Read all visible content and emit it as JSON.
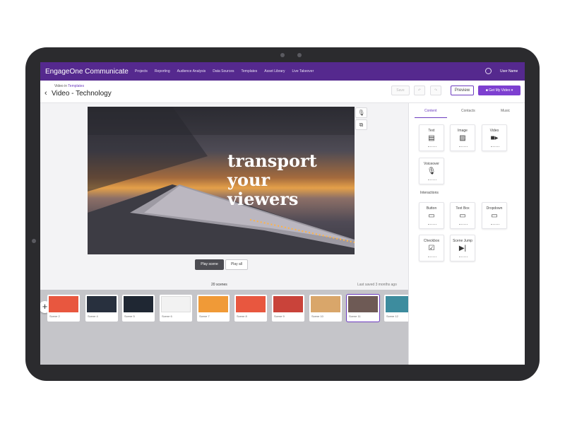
{
  "app": {
    "brand": "EngageOne Communicate",
    "nav": [
      "Projects",
      "Reporting",
      "Audience Analysis",
      "Data Sources",
      "Templates",
      "Asset Library",
      "Live Takeover"
    ],
    "user_name": "User Name"
  },
  "header": {
    "breadcrumb_prefix": "Video in",
    "breadcrumb_link": "Templates",
    "title": "Video - Technology",
    "save_label": "Save",
    "preview_label": "Preview",
    "get_video_label": "Get My Video"
  },
  "canvas": {
    "overlay_lines": [
      "transport",
      "your",
      "viewers"
    ],
    "play_scene_label": "Play scene",
    "play_all_label": "Play all",
    "scene_count": "20 scenes",
    "last_saved": "Last saved 3 months ago",
    "scenes": [
      {
        "label": "Scene 2",
        "color": "#e8573f"
      },
      {
        "label": "Scene 4",
        "color": "#28303e"
      },
      {
        "label": "Scene 5",
        "color": "#1f2733"
      },
      {
        "label": "Scene 6",
        "color": "#f2f2f2"
      },
      {
        "label": "Scene 7",
        "color": "#f09a37"
      },
      {
        "label": "Scene 8",
        "color": "#e8573f"
      },
      {
        "label": "Scene 9",
        "color": "#c9433a"
      },
      {
        "label": "Scene 10",
        "color": "#d9a66a"
      },
      {
        "label": "Scene 11",
        "color": "#6e5a55"
      },
      {
        "label": "Scene 12",
        "color": "#3d8c9e"
      }
    ]
  },
  "panel": {
    "tabs": [
      "Content",
      "Contacts",
      "Music"
    ],
    "content_items": [
      {
        "label": "Text",
        "icon": "text-icon"
      },
      {
        "label": "Image",
        "icon": "image-icon"
      },
      {
        "label": "Video",
        "icon": "video-camera-icon"
      },
      {
        "label": "Voiceover",
        "icon": "microphone-icon"
      }
    ],
    "interactions_label": "Interactions",
    "interaction_items": [
      {
        "label": "Button",
        "icon": "button-cursor-icon"
      },
      {
        "label": "Text Box",
        "icon": "text-box-icon"
      },
      {
        "label": "Dropdown",
        "icon": "dropdown-icon"
      },
      {
        "label": "Checkbox",
        "icon": "checkbox-icon"
      },
      {
        "label": "Scene Jump",
        "icon": "scene-jump-icon"
      }
    ]
  },
  "colors": {
    "brand_purple": "#55298e",
    "accent": "#7d3fd0"
  }
}
